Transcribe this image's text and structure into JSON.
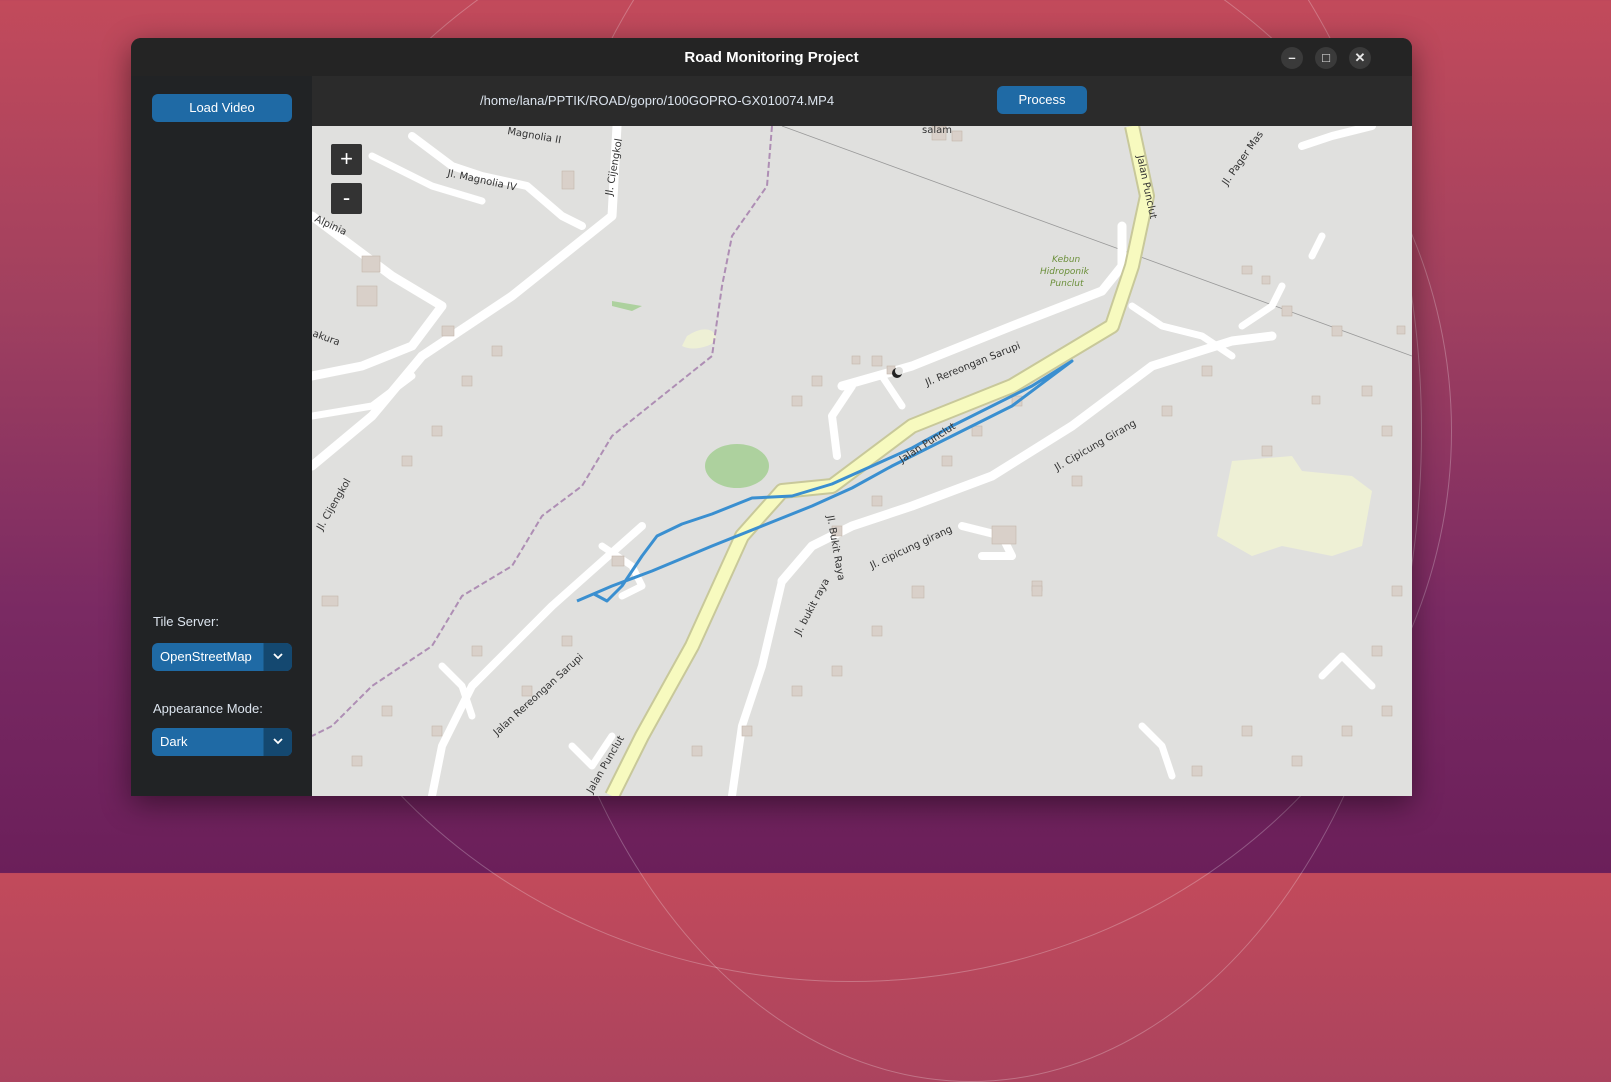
{
  "window": {
    "title": "Road Monitoring Project"
  },
  "window_controls": {
    "minimize": "–",
    "maximize": "□",
    "close": "✕"
  },
  "sidebar": {
    "load_button": "Load Video",
    "tile_server_label": "Tile Server:",
    "tile_server_value": "OpenStreetMap",
    "appearance_label": "Appearance Mode:",
    "appearance_value": "Dark"
  },
  "toolbar": {
    "file_path": "/home/lana/PPTIK/ROAD/gopro/100GOPRO-GX010074.MP4",
    "process_button": "Process"
  },
  "map": {
    "zoom_in": "+",
    "zoom_out": "-",
    "track_color": "#3a8fd0",
    "labels": {
      "magnolia_ii": "Magnolia II",
      "magnolia_iv": "Jl. Magnolia IV",
      "cijengkol_top": "Jl. Cijengkol",
      "cijengkol_left": "Jl. Cijengkol",
      "alpinia": "Alpinia",
      "sakura": "akura",
      "salam": "salam",
      "jalan_punclut_top": "Jalan Punclut",
      "jalan_punclut_mid": "Jalan Punclut",
      "jalan_punclut_bottom": "Jalan Punclut",
      "pager": "Jl. Pager Mas",
      "kebun1": "Kebun",
      "kebun2": "Hidroponik",
      "kebun3": "Punclut",
      "rereongan_top": "Jl. Rereongan Sarupi",
      "rereongan_bottom": "Jalan Rereongan Sarupi",
      "cipicung_girang": "Jl. Cipicung Girang",
      "cipicung_lower": "Jl. cipicung girang",
      "bukit_raya": "Jl. Bukit Raya",
      "bukit_raya_lower": "Jl. bukit raya"
    }
  }
}
